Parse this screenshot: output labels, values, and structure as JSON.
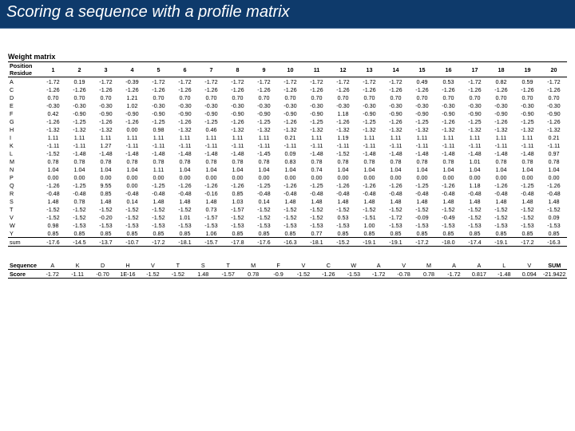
{
  "title": "Scoring a sequence with a profile matrix",
  "weight_label": "Weight matrix",
  "header_left": "Position\nResidue",
  "positions": [
    "1",
    "2",
    "3",
    "4",
    "5",
    "6",
    "7",
    "8",
    "9",
    "10",
    "11",
    "12",
    "13",
    "14",
    "15",
    "16",
    "17",
    "18",
    "19",
    "20"
  ],
  "rows": [
    {
      "r": "A",
      "v": [
        "-1.72",
        "0.19",
        "-1.72",
        "-0.39",
        "-1.72",
        "-1.72",
        "-1.72",
        "-1.72",
        "-1.72",
        "-1.72",
        "-1.72",
        "-1.72",
        "-1.72",
        "-1.72",
        "0.49",
        "0.53",
        "-1.72",
        "0.82",
        "0.59",
        "-1.72"
      ]
    },
    {
      "r": "C",
      "v": [
        "-1.26",
        "-1.26",
        "-1.26",
        "-1.26",
        "-1.26",
        "-1.26",
        "-1.26",
        "-1.26",
        "-1.26",
        "-1.26",
        "-1.26",
        "-1.26",
        "-1.26",
        "-1.26",
        "-1.26",
        "-1.26",
        "-1.26",
        "-1.26",
        "-1.26",
        "-1.26"
      ]
    },
    {
      "r": "D",
      "v": [
        "0.70",
        "0.70",
        "0.70",
        "1.21",
        "0.70",
        "0.70",
        "0.70",
        "0.70",
        "0.70",
        "0.70",
        "0.70",
        "0.70",
        "0.70",
        "0.70",
        "0.70",
        "0.70",
        "0.70",
        "0.70",
        "0.70",
        "0.70"
      ]
    },
    {
      "r": "E",
      "v": [
        "-0.30",
        "-0.30",
        "-0.30",
        "1.02",
        "-0.30",
        "-0.30",
        "-0.30",
        "-0.30",
        "-0.30",
        "-0.30",
        "-0.30",
        "-0.30",
        "-0.30",
        "-0.30",
        "-0.30",
        "-0.30",
        "-0.30",
        "-0.30",
        "-0.30",
        "-0.30"
      ]
    },
    {
      "r": "F",
      "v": [
        "0.42",
        "-0.90",
        "-0.90",
        "-0.90",
        "-0.90",
        "-0.90",
        "-0.90",
        "-0.90",
        "-0.90",
        "-0.90",
        "-0.90",
        "1.18",
        "-0.90",
        "-0.90",
        "-0.90",
        "-0.90",
        "-0.90",
        "-0.90",
        "-0.90",
        "-0.90"
      ]
    },
    {
      "r": "G",
      "v": [
        "-1.26",
        "-1.25",
        "-1.26",
        "-1.26",
        "-1.25",
        "-1.26",
        "-1.25",
        "-1.26",
        "-1.25",
        "-1.26",
        "-1.25",
        "-1.26",
        "-1.25",
        "-1.26",
        "-1.25",
        "-1.26",
        "-1.25",
        "-1.26",
        "-1.25",
        "-1.26"
      ]
    },
    {
      "r": "H",
      "v": [
        "-1.32",
        "-1.32",
        "-1.32",
        "0.00",
        "0.98",
        "-1.32",
        "0.46",
        "-1.32",
        "-1.32",
        "-1.32",
        "-1.32",
        "-1.32",
        "-1.32",
        "-1.32",
        "-1.32",
        "-1.32",
        "-1.32",
        "-1.32",
        "-1.32",
        "-1.32"
      ]
    },
    {
      "r": "I",
      "v": [
        "1.11",
        "1.11",
        "1.11",
        "1.11",
        "1.11",
        "1.11",
        "1.11",
        "1.11",
        "1.11",
        "0.21",
        "1.11",
        "1.19",
        "1.11",
        "1.11",
        "1.11",
        "1.11",
        "1.11",
        "1.11",
        "1.11",
        "0.21"
      ]
    },
    {
      "r": "K",
      "v": [
        "-1.11",
        "-1.11",
        "1.27",
        "-1.11",
        "-1.11",
        "-1.11",
        "-1.11",
        "-1.11",
        "-1.11",
        "-1.11",
        "-1.11",
        "-1.11",
        "-1.11",
        "-1.11",
        "-1.11",
        "-1.11",
        "-1.11",
        "-1.11",
        "-1.11",
        "-1.11"
      ]
    },
    {
      "r": "L",
      "v": [
        "-1.52",
        "-1.48",
        "-1.48",
        "-1.48",
        "-1.48",
        "-1.48",
        "-1.48",
        "-1.48",
        "-1.45",
        "0.09",
        "-1.48",
        "-1.52",
        "-1.48",
        "-1.48",
        "-1.48",
        "-1.48",
        "-1.48",
        "-1.48",
        "-1.48",
        "0.97"
      ]
    },
    {
      "r": "M",
      "v": [
        "0.78",
        "0.78",
        "0.78",
        "0.78",
        "0.78",
        "0.78",
        "0.78",
        "0.78",
        "0.78",
        "0.83",
        "0.78",
        "0.78",
        "0.78",
        "0.78",
        "0.78",
        "0.78",
        "1.01",
        "0.78",
        "0.78",
        "0.78"
      ]
    },
    {
      "r": "N",
      "v": [
        "1.04",
        "1.04",
        "1.04",
        "1.04",
        "1.11",
        "1.04",
        "1.04",
        "1.04",
        "1.04",
        "1.04",
        "0.74",
        "1.04",
        "1.04",
        "1.04",
        "1.04",
        "1.04",
        "1.04",
        "1.04",
        "1.04",
        "1.04"
      ]
    },
    {
      "r": "P",
      "v": [
        "0.00",
        "0.00",
        "0.00",
        "0.00",
        "0.00",
        "0.00",
        "0.00",
        "0.00",
        "0.00",
        "0.00",
        "0.00",
        "0.00",
        "0.00",
        "0.00",
        "0.00",
        "0.00",
        "0.00",
        "0.00",
        "0.00",
        "0.00"
      ]
    },
    {
      "r": "Q",
      "v": [
        "-1.26",
        "-1.25",
        "9.55",
        "0.00",
        "-1.25",
        "-1.26",
        "-1.26",
        "-1.26",
        "-1.25",
        "-1.26",
        "-1.25",
        "-1.26",
        "-1.26",
        "-1.26",
        "-1.25",
        "-1.26",
        "1.18",
        "-1.26",
        "-1.25",
        "-1.26"
      ]
    },
    {
      "r": "R",
      "v": [
        "-0.48",
        "-0.48",
        "0.85",
        "-0.48",
        "-0.48",
        "-0.48",
        "-0.16",
        "0.85",
        "-0.48",
        "-0.48",
        "-0.48",
        "-0.48",
        "-0.48",
        "-0.48",
        "-0.48",
        "-0.48",
        "-0.48",
        "-0.48",
        "-0.48",
        "-0.48"
      ]
    },
    {
      "r": "S",
      "v": [
        "1.48",
        "0.78",
        "1.48",
        "0.14",
        "1.48",
        "1.48",
        "1.48",
        "1.03",
        "0.14",
        "1.48",
        "1.48",
        "1.48",
        "1.48",
        "1.48",
        "1.48",
        "1.48",
        "1.48",
        "1.48",
        "1.48",
        "1.48"
      ]
    },
    {
      "r": "T",
      "v": [
        "-1.52",
        "-1.52",
        "-1.52",
        "-1.52",
        "-1.52",
        "-1.52",
        "0.73",
        "-1.57",
        "-1.52",
        "-1.52",
        "-1.52",
        "-1.52",
        "-1.52",
        "-1.52",
        "-1.52",
        "-1.52",
        "-1.52",
        "-1.52",
        "-1.52",
        "-1.52"
      ]
    },
    {
      "r": "V",
      "v": [
        "-1.52",
        "-1.52",
        "-0.20",
        "-1.52",
        "-1.52",
        "1.01",
        "-1.57",
        "-1.52",
        "-1.52",
        "-1.52",
        "-1.52",
        "0.53",
        "-1.51",
        "-1.72",
        "-0.09",
        "-0.49",
        "-1.52",
        "-1.52",
        "-1.52",
        "0.09"
      ]
    },
    {
      "r": "W",
      "v": [
        "0.98",
        "-1.53",
        "-1.53",
        "-1.53",
        "-1.53",
        "-1.53",
        "-1.53",
        "-1.53",
        "-1.53",
        "-1.53",
        "-1.53",
        "-1.53",
        "1.00",
        "-1.53",
        "-1.53",
        "-1.53",
        "-1.53",
        "-1.53",
        "-1.53",
        "-1.53"
      ]
    },
    {
      "r": "Y",
      "v": [
        "0.85",
        "0.85",
        "0.85",
        "0.85",
        "0.85",
        "0.85",
        "1.06",
        "0.85",
        "0.85",
        "0.85",
        "0.77",
        "0.85",
        "0.85",
        "0.85",
        "0.85",
        "0.85",
        "0.85",
        "0.85",
        "0.85",
        "0.85"
      ]
    }
  ],
  "sum_label": "sum",
  "sum": [
    "-17.6",
    "-14.5",
    "-13.7",
    "-10.7",
    "-17.2",
    "-18.1",
    "-15.7",
    "-17.8",
    "-17.6",
    "-16.3",
    "-18.1",
    "-15.2",
    "-19.1",
    "-19.1",
    "-17.2",
    "-18.0",
    "-17.4",
    "-19.1",
    "-17.2",
    "-16.3"
  ],
  "seq_label": "Sequence",
  "score_label": "Score",
  "sum_label2": "SUM",
  "sequence": [
    "A",
    "K",
    "D",
    "H",
    "V",
    "T",
    "S",
    "T",
    "M",
    "F",
    "V",
    "C",
    "W",
    "A",
    "V",
    "M",
    "A",
    "A",
    "L",
    "V"
  ],
  "scores": [
    "-1.72",
    "-1.11",
    "-0.70",
    "1E-16",
    "-1.52",
    "-1.52",
    "1.48",
    "-1.57",
    "0.78",
    "-0.9",
    "-1.52",
    "-1.26",
    "-1.53",
    "-1.72",
    "-0.78",
    "0.78",
    "-1.72",
    "0.817",
    "-1.48",
    "0.094"
  ],
  "score_sum": "-21.9422"
}
